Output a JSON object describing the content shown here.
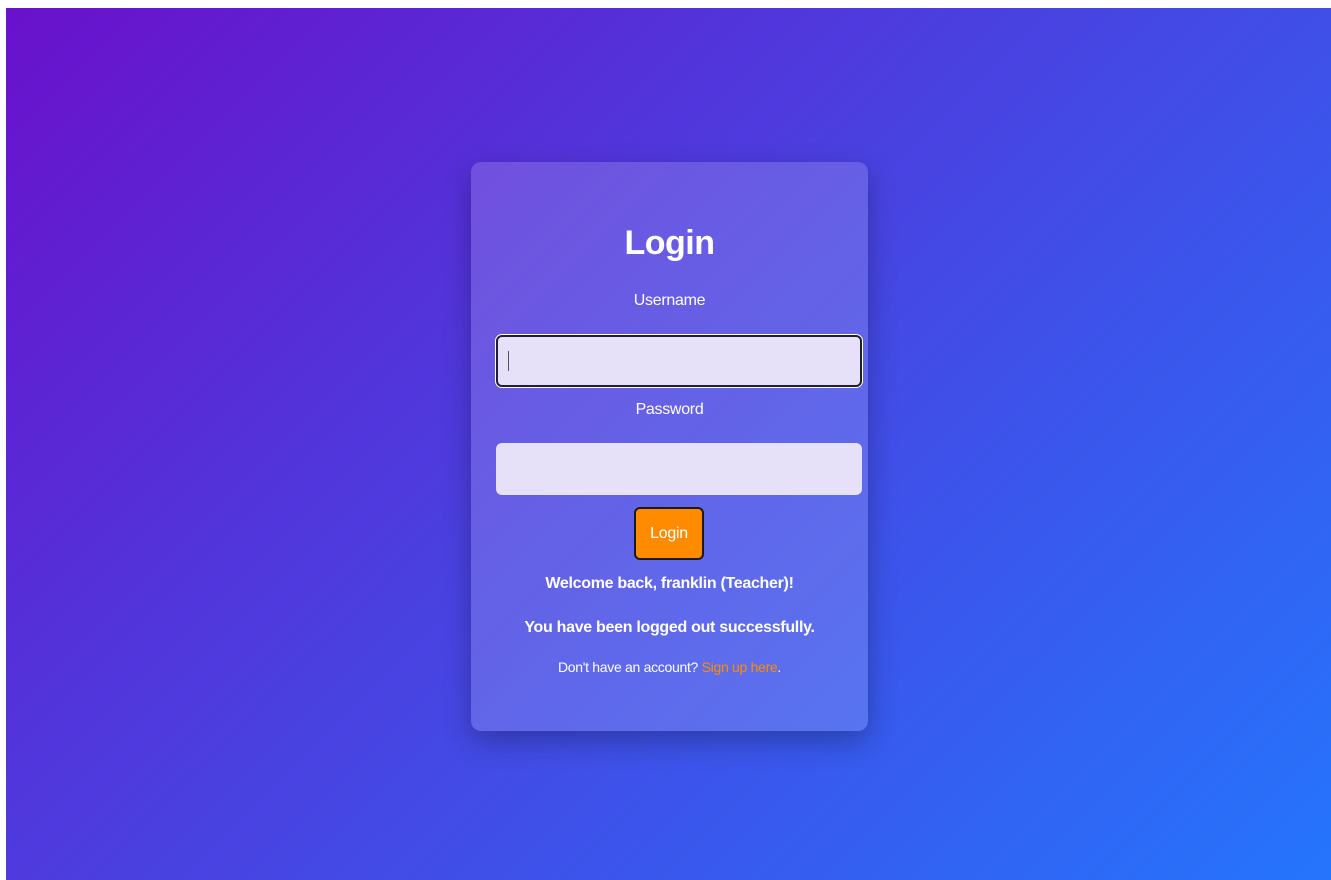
{
  "login_form": {
    "title": "Login",
    "username_label": "Username",
    "username_value": "",
    "password_label": "Password",
    "password_value": "",
    "submit_label": "Login",
    "welcome_message": "Welcome back, franklin (Teacher)!",
    "logout_message": "You have been logged out successfully.",
    "signup_prompt": "Don't have an account?",
    "signup_link": "Sign up here",
    "signup_suffix": "."
  },
  "colors": {
    "gradient_start": "#6a11cb",
    "gradient_end": "#2575fc",
    "accent": "#ff8c00",
    "input_background": "#e6e1f9"
  }
}
